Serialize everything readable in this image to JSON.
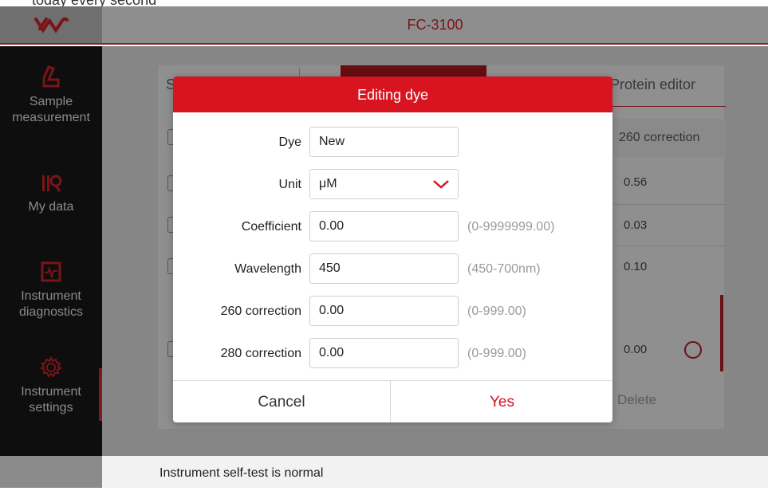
{
  "app": {
    "title": "FC-3100",
    "top_cut_text": "today every second"
  },
  "sidebar": {
    "items": [
      {
        "label": "Sample\nmeasurement",
        "icon": "flask-icon"
      },
      {
        "label": "My data",
        "icon": "data-icon"
      },
      {
        "label": "Instrument\ndiagnostics",
        "icon": "monitor-pulse-icon"
      },
      {
        "label": "Instrument\nsettings",
        "icon": "gear-icon"
      }
    ],
    "active": "Instrument settings"
  },
  "background": {
    "tab_partial": "S",
    "tab_protein": "Protein editor",
    "column_260": "260 correction",
    "values": [
      "0.56",
      "0.03",
      "0.10"
    ],
    "row_value": "0.00",
    "delete_label": "Delete"
  },
  "status_bar": {
    "message": "Instrument self-test is normal"
  },
  "dialog": {
    "title": "Editing dye",
    "fields": {
      "dye": {
        "label": "Dye",
        "value": "New"
      },
      "unit": {
        "label": "Unit",
        "value": "μM"
      },
      "coefficient": {
        "label": "Coefficient",
        "value": "0.00",
        "hint": "(0-9999999.00)"
      },
      "wavelength": {
        "label": "Wavelength",
        "value": "450",
        "hint": "(450-700nm)"
      },
      "corr260": {
        "label": "260 correction",
        "value": "0.00",
        "hint": "(0-999.00)"
      },
      "corr280": {
        "label": "280 correction",
        "value": "0.00",
        "hint": "(0-999.00)"
      }
    },
    "cancel_label": "Cancel",
    "yes_label": "Yes"
  },
  "colors": {
    "accent": "#d7141f",
    "overlay_dark": "#0e0e0e"
  }
}
